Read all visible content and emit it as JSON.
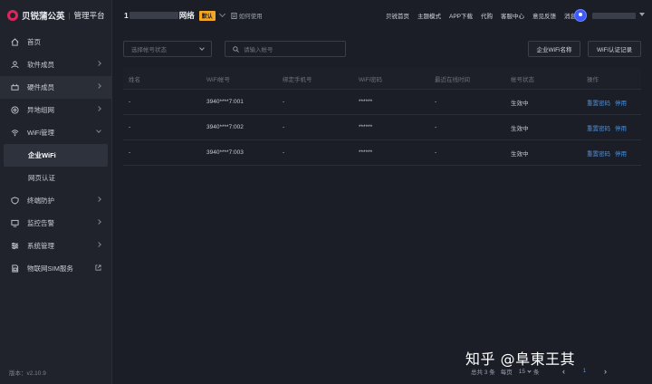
{
  "brand": {
    "name": "贝锐蒲公英",
    "separator": "|",
    "platform": "管理平台"
  },
  "sidebar": {
    "items": [
      {
        "label": "首页",
        "icon": "home-icon"
      },
      {
        "label": "软件成员",
        "icon": "user-icon"
      },
      {
        "label": "硬件成员",
        "icon": "device-icon"
      },
      {
        "label": "异地组网",
        "icon": "network-icon"
      },
      {
        "label": "WiFi管理",
        "icon": "wifi-icon"
      },
      {
        "label": "终端防护",
        "icon": "shield-icon"
      },
      {
        "label": "监控告警",
        "icon": "monitor-icon"
      },
      {
        "label": "系统管理",
        "icon": "settings-icon"
      },
      {
        "label": "物联网SIM服务",
        "icon": "sim-icon"
      }
    ],
    "wifi_sub": [
      "企业WiFi",
      "网页认证"
    ],
    "version": "版本：v2.10.9"
  },
  "header": {
    "network_prefix": "1",
    "network_suffix": "网络",
    "default_badge": "默认",
    "howto": "如何使用",
    "links": [
      "贝锐首页",
      "主题模式",
      "APP下载",
      "代购",
      "客服中心",
      "意见反馈",
      "消息"
    ]
  },
  "filters": {
    "status_placeholder": "选择帐号状态",
    "search_placeholder": "请输入帐号",
    "btn_wifi_name": "企业WiFi名称",
    "btn_auth_log": "WiFi认证记录"
  },
  "table": {
    "headers": [
      "姓名",
      "WiFi帐号",
      "绑定手机号",
      "WiFi密码",
      "最近在线时间",
      "帐号状态",
      "操作"
    ],
    "rows": [
      {
        "name": "-",
        "account": "3940****7:001",
        "phone": "-",
        "password": "******",
        "last_online": "-",
        "status": "生效中",
        "op_reset": "重置密码",
        "op_disable": "停用"
      },
      {
        "name": "-",
        "account": "3940****7:002",
        "phone": "-",
        "password": "******",
        "last_online": "-",
        "status": "生效中",
        "op_reset": "重置密码",
        "op_disable": "停用"
      },
      {
        "name": "-",
        "account": "3940****7:003",
        "phone": "-",
        "password": "******",
        "last_online": "-",
        "status": "生效中",
        "op_reset": "重置密码",
        "op_disable": "停用"
      }
    ]
  },
  "pagination": {
    "total": "总共 3 条",
    "per_page_label": "每页",
    "per_page": "15",
    "unit": "条",
    "prev": "‹",
    "current": "1",
    "next": "›"
  },
  "watermark": "知乎 @阜東王其",
  "colors": {
    "accent": "#4a90e2",
    "success": "#52c41a",
    "badge": "#f5a623",
    "brand": "#e0245e"
  }
}
